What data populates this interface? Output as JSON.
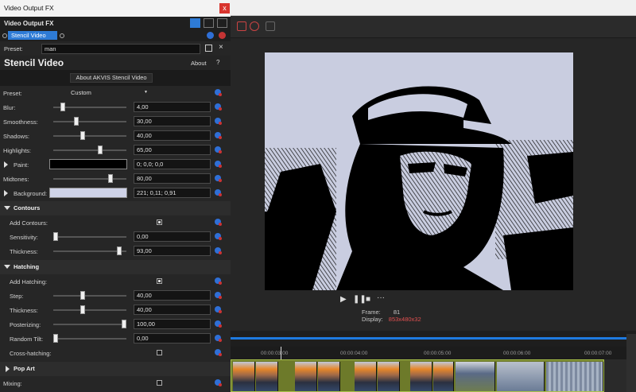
{
  "fx_window": {
    "title": "Video Output FX",
    "close": "x",
    "header_label": "Video Output FX",
    "chain_item": "Stencil Video",
    "preset_label": "Preset:",
    "preset_value": "man"
  },
  "plugin": {
    "title": "Stencil Video",
    "about_link": "About",
    "help_link": "?",
    "about_button": "About AKVIS Stencil Video",
    "preset_label": "Preset:",
    "preset_value": "Custom"
  },
  "params": {
    "blur": {
      "label": "Blur:",
      "value": "4,00",
      "level": 0.1
    },
    "smoothness": {
      "label": "Smoothness:",
      "value": "30,00",
      "level": 0.3
    },
    "shadows": {
      "label": "Shadows:",
      "value": "40,00",
      "level": 0.4
    },
    "highlights": {
      "label": "Highlights:",
      "value": "65,00",
      "level": 0.65
    },
    "paint": {
      "label": "Paint:",
      "value": "0; 0,0; 0,0",
      "color": "#000000"
    },
    "midtones": {
      "label": "Midtones:",
      "value": "80,00",
      "level": 0.8
    },
    "background": {
      "label": "Background:",
      "value": "221; 0,11; 0,91",
      "color": "#cfd3e8"
    }
  },
  "contours": {
    "title": "Contours",
    "add_label": "Add Contours:",
    "add_checked": true,
    "sensitivity": {
      "label": "Sensitivity:",
      "value": "0,00",
      "level": 0.0
    },
    "thickness": {
      "label": "Thickness:",
      "value": "93,00",
      "level": 0.93
    }
  },
  "hatching": {
    "title": "Hatching",
    "add_label": "Add Hatching:",
    "add_checked": true,
    "step": {
      "label": "Step:",
      "value": "40,00",
      "level": 0.4
    },
    "thickness": {
      "label": "Thickness:",
      "value": "40,00",
      "level": 0.4
    },
    "posterizing": {
      "label": "Posterizing:",
      "value": "100,00",
      "level": 1.0
    },
    "random_tilt": {
      "label": "Random Tilt:",
      "value": "0,00",
      "level": 0.0
    },
    "cross_label": "Cross-hatching:",
    "cross_checked": false
  },
  "pop_art": {
    "title": "Pop Art",
    "mixing_label": "Mixing:",
    "mixing_checked": false
  },
  "preview": {
    "frame_label": "Frame:",
    "frame_value": "81",
    "display_label": "Display:",
    "display_value": "853x480x32",
    "display_color": "#e05050"
  },
  "timeline": {
    "ticks": [
      "00:00:03:00",
      "00:00:04:00",
      "00:00:05:00",
      "00:00:06:00",
      "00:00:07:00"
    ]
  }
}
